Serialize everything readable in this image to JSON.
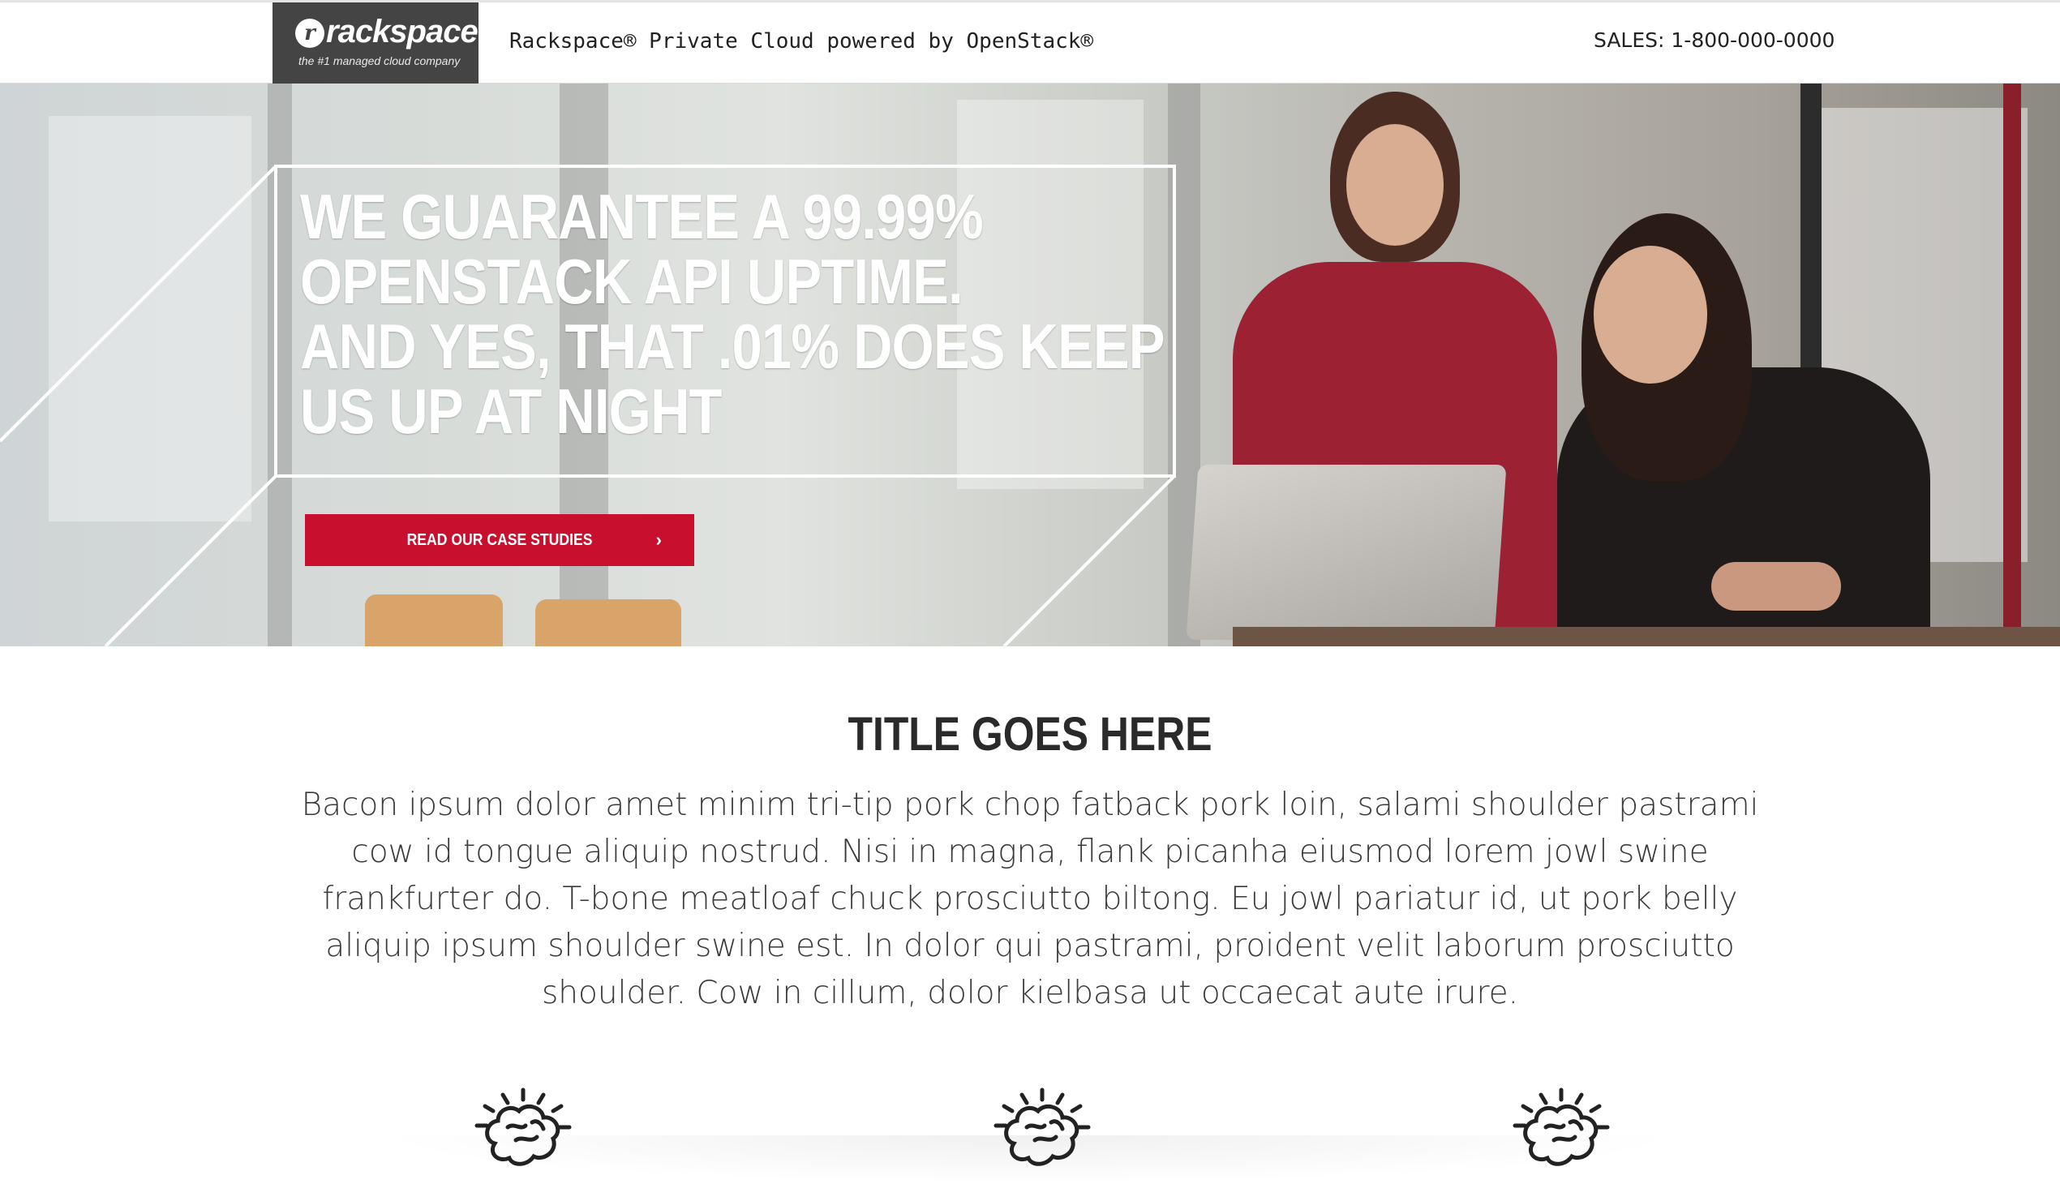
{
  "header": {
    "logo": {
      "word": "rackspace",
      "tagline": "the #1 managed cloud company"
    },
    "title": "Rackspace® Private Cloud powered by OpenStack®",
    "sales": "SALES: 1-800-000-0000"
  },
  "hero": {
    "headline_lines": [
      "WE GUARANTEE A 99.99%",
      "OPENSTACK API UPTIME.",
      "AND YES, THAT .01% DOES KEEP",
      "US UP AT NIGHT"
    ],
    "cta_label": "READ OUR CASE STUDIES",
    "cta_icon": "chevron-right-icon",
    "cta_color": "#c8102e"
  },
  "content": {
    "title": "TITLE GOES HERE",
    "body": "Bacon ipsum dolor amet minim tri-tip pork chop fatback pork loin, salami shoulder pastrami cow id tongue aliquip nostrud. Nisi in magna, flank picanha eiusmod lorem jowl swine frankfurter do. T-bone meatloaf chuck prosciutto biltong. Eu jowl pariatur id, ut pork belly aliquip ipsum shoulder swine est. In dolor qui pastrami, proident velit laborum prosciutto shoulder. Cow in cillum, dolor kielbasa ut occaecat aute irure."
  },
  "features": [
    {
      "icon": "brain-idea-icon"
    },
    {
      "icon": "brain-idea-icon"
    },
    {
      "icon": "brain-idea-icon"
    }
  ]
}
